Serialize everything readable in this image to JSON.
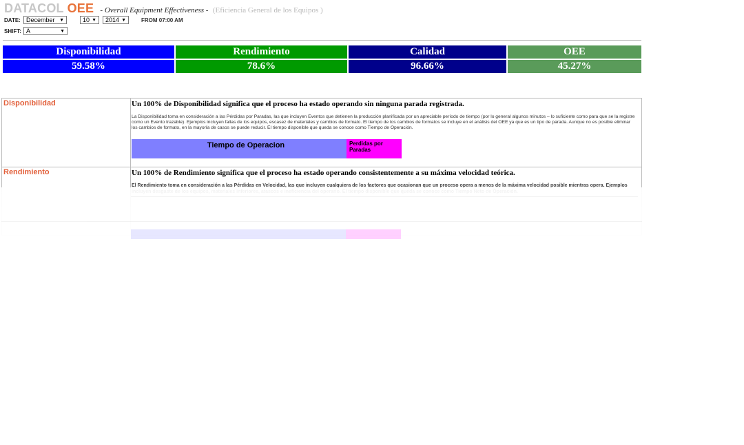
{
  "header": {
    "brand_part1": "DATACOL",
    "brand_part2": "OEE",
    "subtitle": "- Overall Equipment Effectiveness -",
    "subtitle_es": "(Eficiencia General de los Equipos )"
  },
  "filters": {
    "date_label": "DATE:",
    "month": "December",
    "day": "10",
    "year": "2014",
    "from_text": "FROM 07:00 AM",
    "shift_label": "SHIFT:",
    "shift": "A"
  },
  "kpis": [
    {
      "name": "Disponibilidad",
      "value": "59.58%",
      "color": "#0000ff"
    },
    {
      "name": "Rendimiento",
      "value": "78.6%",
      "color": "#009a00"
    },
    {
      "name": "Calidad",
      "value": "96.66%",
      "color": "#00008b"
    },
    {
      "name": "OEE",
      "value": "45.27%",
      "color": "#5a9b5a"
    }
  ],
  "sections": {
    "availability": {
      "title": "Disponibilidad",
      "heading": "Un 100% de Disponibilidad significa que el proceso ha estado operando sin ninguna parada registrada.",
      "body": "La Disponibilidad toma en consideración a las Pérdidas por Paradas, las que incluyen Eventos que detienen la producción planificada por un apreciable período de tiempo (por lo general algunos minutos – lo suficiente como para que se la registre como un Evento trazable). Ejemplos incluyen fallas de los equipos, escasez de materiales y cambios de formato. El tiempo de los cambios de formatos se incluye en el análisis del OEE ya que es un tipo de parada. Aunque no es posible eliminar los cambios de formato, en la mayoría de casos se puede reducir. El tiempo disponible que queda se conoce como Tiempo de Operación.",
      "bar_operating": "Tiempo de Operacion",
      "bar_losses": "Perdidas por Paradas"
    },
    "performance": {
      "title": "Rendimiento",
      "heading": "Un 100% de Rendimiento significa que el proceso ha estado operando consistentemente a su máxima velocidad teórica.",
      "body": "El Rendimiento toma en consideración a las Pérdidas en Velocidad, las que incluyen cualquiera de los factores que ocasionan que un proceso opera a menos de la máxima velocidad posible mientras opera. Ejemplos incluyen desgaste de los equipos, materiales inferiores, atascos e ineficiencia del operario. El tiempo disponible que queda se conoce como Tiempo Neto de Operación."
    }
  }
}
